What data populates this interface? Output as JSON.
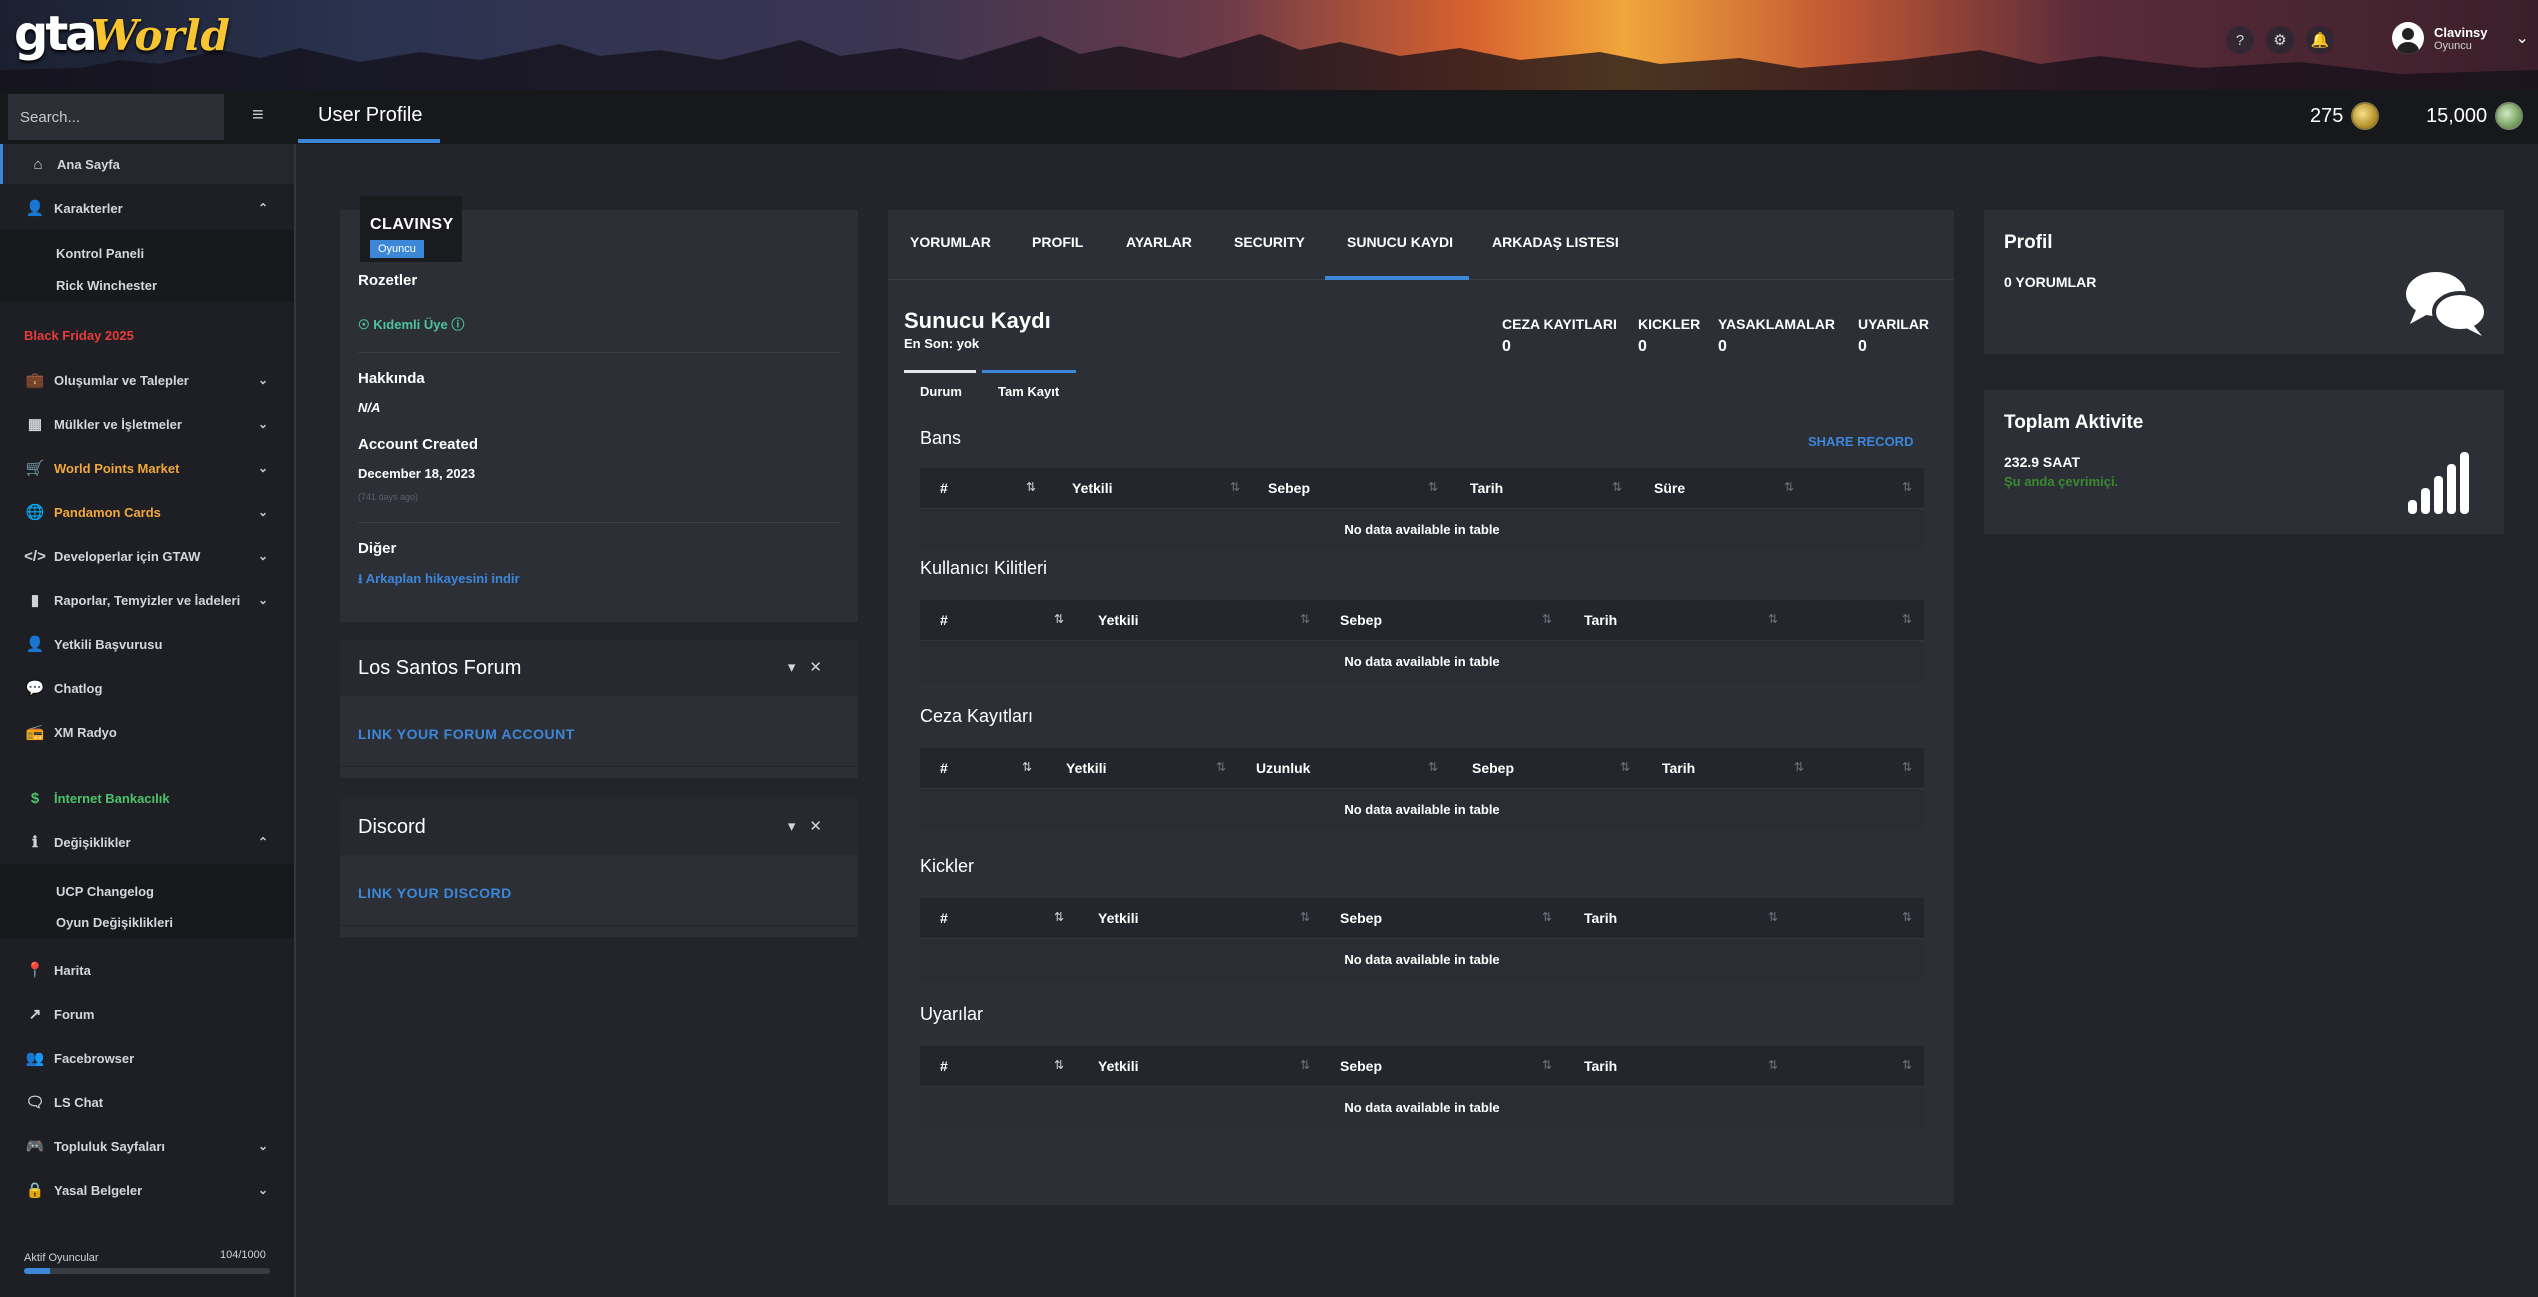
{
  "header": {
    "logo_gta": "gta",
    "logo_world": "World",
    "user_name": "Clavinsy",
    "user_role": "Oyuncu"
  },
  "topbar": {
    "search_placeholder": "Search...",
    "page_title": "User Profile",
    "points": "275",
    "money": "15,000"
  },
  "sidebar": {
    "items": [
      {
        "label": "Ana Sayfa",
        "icon": "home-icon"
      },
      {
        "label": "Karakterler",
        "icon": "user-icon"
      },
      {
        "label": "Kontrol Paneli"
      },
      {
        "label": "Rick Winchester"
      },
      {
        "label": "Black Friday 2025"
      },
      {
        "label": "Oluşumlar ve Talepler",
        "icon": "briefcase-icon"
      },
      {
        "label": "Mülkler ve İşletmeler",
        "icon": "building-icon"
      },
      {
        "label": "World Points Market",
        "icon": "cart-icon"
      },
      {
        "label": "Pandamon Cards",
        "icon": "globe-icon"
      },
      {
        "label": "Developerlar için GTAW",
        "icon": "code-icon"
      },
      {
        "label": "Raporlar, Temyizler ve İadeleri",
        "icon": "book-icon"
      },
      {
        "label": "Yetkili Başvurusu",
        "icon": "user-icon"
      },
      {
        "label": "Chatlog",
        "icon": "comment-icon"
      },
      {
        "label": "XM Radyo",
        "icon": "radio-icon"
      },
      {
        "label": "İnternet Bankacılık",
        "icon": "dollar-icon"
      },
      {
        "label": "Değişiklikler",
        "icon": "info-icon"
      },
      {
        "label": "UCP Changelog"
      },
      {
        "label": "Oyun Değişiklikleri"
      },
      {
        "label": "Harita",
        "icon": "map-pin-icon"
      },
      {
        "label": "Forum",
        "icon": "external-link-icon"
      },
      {
        "label": "Facebrowser",
        "icon": "users-icon"
      },
      {
        "label": "LS Chat",
        "icon": "comments-icon"
      },
      {
        "label": "Topluluk Sayfaları",
        "icon": "discord-icon"
      },
      {
        "label": "Yasal Belgeler",
        "icon": "lock-icon"
      }
    ],
    "online_label": "Aktif Oyuncular",
    "online_count": "104/1000",
    "online_fraction": 0.104
  },
  "profile": {
    "name": "CLAVINSY",
    "role": "Oyuncu",
    "badges_label": "Rozetler",
    "badge": "Kıdemli Üye",
    "about_label": "Hakkında",
    "about_value": "N/A",
    "created_label": "Account Created",
    "created_value": "December 18, 2023",
    "days_ago": "(741 days ago)",
    "other_label": "Diğer",
    "download_link": "Arkaplan hikayesini indir"
  },
  "forum_widget": {
    "title": "Los Santos Forum",
    "link": "LINK YOUR FORUM ACCOUNT"
  },
  "discord_widget": {
    "title": "Discord",
    "link": "LINK YOUR DISCORD"
  },
  "tabs": [
    "YORUMLAR",
    "PROFIL",
    "AYARLAR",
    "SECURITY",
    "SUNUCU KAYDI",
    "ARKADAŞ LISTESI"
  ],
  "record": {
    "title": "Sunucu Kaydı",
    "subtitle": "En Son: yok",
    "stats": [
      {
        "label": "CEZA KAYITLARI",
        "value": "0"
      },
      {
        "label": "KICKLER",
        "value": "0"
      },
      {
        "label": "YASAKLAMALAR",
        "value": "0"
      },
      {
        "label": "UYARILAR",
        "value": "0"
      }
    ],
    "subtabs": [
      "Durum",
      "Tam Kayıt"
    ],
    "share": "SHARE RECORD",
    "empty": "No data available in table",
    "sections": [
      {
        "title": "Bans",
        "cols": [
          "#",
          "Yetkili",
          "Sebep",
          "Tarih",
          "Süre",
          ""
        ]
      },
      {
        "title": "Kullanıcı Kilitleri",
        "cols": [
          "#",
          "Yetkili",
          "Sebep",
          "Tarih",
          ""
        ]
      },
      {
        "title": "Ceza Kayıtları",
        "cols": [
          "#",
          "Yetkili",
          "Uzunluk",
          "Sebep",
          "Tarih",
          ""
        ]
      },
      {
        "title": "Kickler",
        "cols": [
          "#",
          "Yetkili",
          "Sebep",
          "Tarih",
          ""
        ]
      },
      {
        "title": "Uyarılar",
        "cols": [
          "#",
          "Yetkili",
          "Sebep",
          "Tarih",
          ""
        ]
      }
    ]
  },
  "right": {
    "profile_title": "Profil",
    "comments": "0 YORUMLAR",
    "activity_title": "Toplam Aktivite",
    "hours": "232.9 SAAT",
    "online_now": "Şu anda çevrimiçi."
  }
}
